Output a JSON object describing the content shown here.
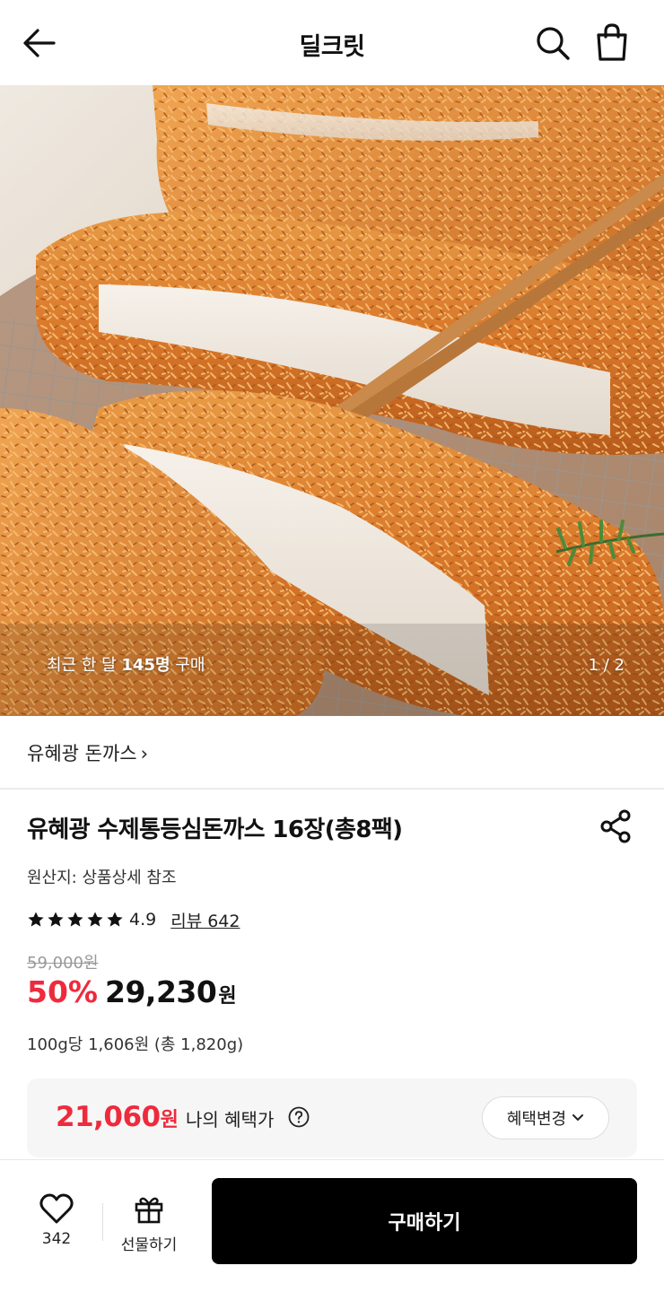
{
  "header": {
    "title": "딜크릿",
    "icons": {
      "back": "arrow-left-icon",
      "search": "search-icon",
      "cart": "shopping-bag-icon"
    }
  },
  "gallery": {
    "caption_prefix": "최근 한 달 ",
    "caption_bold": "145명",
    "caption_suffix": " 구매",
    "pager": "1 / 2"
  },
  "brand": {
    "label": "유혜광 돈까스",
    "chevron": "›"
  },
  "product": {
    "title": "유혜광 수제통등심돈까스 16장(총8팩)",
    "origin": "원산지: 상품상세 참조",
    "rating": "4.9",
    "stars": 5,
    "review": "리뷰 642",
    "original_price": "59,000원",
    "discount": "50%",
    "price": "29,230",
    "price_unit": "원",
    "unit_price": "100g당 1,606원 (총 1,820g)"
  },
  "benefit": {
    "price": "21,060",
    "price_unit": "원",
    "label": "나의 혜택가",
    "change_button": "혜택변경"
  },
  "bottom": {
    "like_count": "342",
    "gift_label": "선물하기",
    "buy_label": "구매하기"
  },
  "colors": {
    "accent_red": "#ee2a3c",
    "buy_button": "#000000"
  }
}
